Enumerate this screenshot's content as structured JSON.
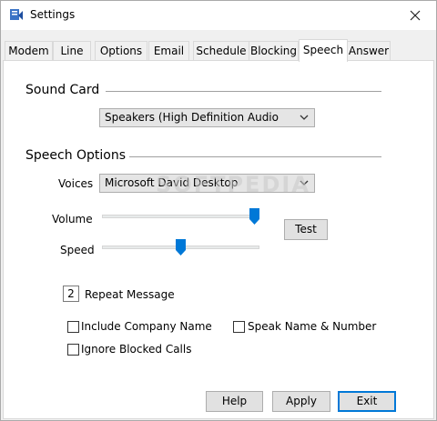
{
  "window": {
    "title": "Settings"
  },
  "tabs": [
    {
      "label": "Modem"
    },
    {
      "label": "Line"
    },
    {
      "label": "Options"
    },
    {
      "label": "Email"
    },
    {
      "label": "Schedule"
    },
    {
      "label": "Blocking"
    },
    {
      "label": "Speech",
      "active": true
    },
    {
      "label": "Answer"
    }
  ],
  "sound_card": {
    "heading": "Sound Card",
    "device": "Speakers (High Definition Audio"
  },
  "speech_options": {
    "heading": "Speech Options",
    "voices_label": "Voices",
    "voice": "Microsoft David Desktop",
    "volume_label": "Volume",
    "volume_level": 1.0,
    "speed_label": "Speed",
    "speed_level": 0.5,
    "test_button": "Test"
  },
  "repeat": {
    "count": "2",
    "label": "Repeat Message"
  },
  "checkboxes": {
    "include_company_name": {
      "label": "Include Company Name",
      "checked": false
    },
    "speak_name_number": {
      "label": "Speak Name & Number",
      "checked": false
    },
    "ignore_blocked_calls": {
      "label": "Ignore Blocked Calls",
      "checked": false
    }
  },
  "buttons": {
    "help": "Help",
    "apply": "Apply",
    "exit": "Exit"
  },
  "watermark": "SOFTPEDIA",
  "colors": {
    "accent": "#0078d7",
    "button_face": "#e1e1e1",
    "combo_face": "#e5e5e5"
  },
  "icons": {
    "app": "settings-app-icon",
    "close": "close-icon",
    "dropdown": "chevron-down-icon"
  }
}
